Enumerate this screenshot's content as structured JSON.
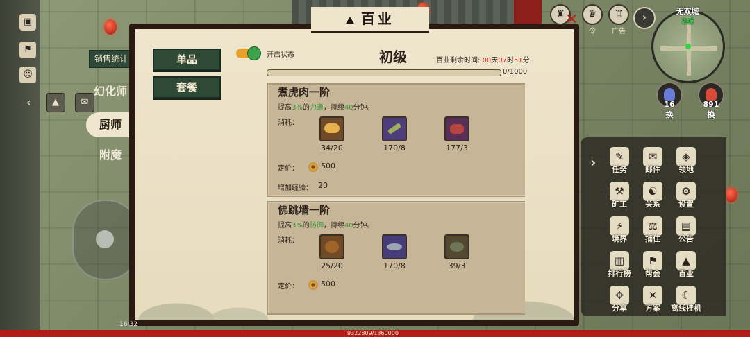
{
  "panel": {
    "title": "百业",
    "sidebar_sales": "销售统计",
    "categories": [
      {
        "label": "幻化师",
        "active": false
      },
      {
        "label": "厨师",
        "active": true
      },
      {
        "label": "附魔",
        "active": false
      }
    ],
    "sub_tabs": [
      "单品",
      "套餐"
    ],
    "toggle_label": "开启状态",
    "toggle_on": true,
    "level": "初级",
    "timer": {
      "prefix": "百业剩余时间:",
      "days": "00",
      "day_unit": "天",
      "hours": "07",
      "hour_unit": "时",
      "minutes": "51",
      "minute_unit": "分"
    },
    "progress": {
      "text": "0/1000",
      "fraction": 0.0
    },
    "consume_label": "消耗：",
    "price_label": "定价：",
    "exp_label": "增加经验：",
    "recipes": [
      {
        "name": "煮虎肉一阶",
        "desc_prefix": "提高",
        "desc_pct": "3%",
        "desc_mid": "的",
        "desc_stat": "力道",
        "desc_sep": "，持续",
        "desc_dur": "40",
        "desc_suffix": "分钟。",
        "materials": [
          {
            "icon": "bread-icon",
            "qty": "34/20"
          },
          {
            "icon": "herb-icon",
            "qty": "170/8"
          },
          {
            "icon": "meat-icon",
            "qty": "177/3"
          }
        ],
        "price": "500",
        "exp": "20"
      },
      {
        "name": "佛跳墙一阶",
        "desc_prefix": "提高",
        "desc_pct": "3%",
        "desc_mid": "的",
        "desc_stat": "防御",
        "desc_sep": "，持续",
        "desc_dur": "40",
        "desc_suffix": "分钟。",
        "materials": [
          {
            "icon": "nuts-icon",
            "qty": "25/20"
          },
          {
            "icon": "fish-icon",
            "qty": "170/8"
          },
          {
            "icon": "turtle-icon",
            "qty": "39/3"
          }
        ],
        "price": "500"
      }
    ]
  },
  "hud": {
    "top_icons": [
      {
        "icon": "gift-icon",
        "label": ""
      },
      {
        "icon": "order-icon",
        "label": "令"
      },
      {
        "icon": "ad-icon",
        "label": "广告"
      }
    ],
    "map_name": "无双城",
    "map_line": "2线",
    "potions": [
      {
        "icon": "blue-potion-icon",
        "count": "16",
        "label": "换"
      },
      {
        "icon": "red-potion-icon",
        "count": "891",
        "label": "换"
      }
    ],
    "menu": [
      {
        "icon": "task-icon",
        "glyph": "✎",
        "label": "任务"
      },
      {
        "icon": "mail-icon",
        "glyph": "✉",
        "label": "邮件"
      },
      {
        "icon": "claim-icon",
        "glyph": "◈",
        "label": "领地"
      },
      {
        "icon": "mining-icon",
        "glyph": "⚒",
        "label": "矿工"
      },
      {
        "icon": "relation-icon",
        "glyph": "☯",
        "label": "关系"
      },
      {
        "icon": "settings-icon",
        "glyph": "⚙",
        "label": "设置"
      },
      {
        "icon": "realm-icon",
        "glyph": "⚡",
        "label": "境界"
      },
      {
        "icon": "balance-icon",
        "glyph": "⚖",
        "label": "捕住"
      },
      {
        "icon": "notice-icon",
        "glyph": "▤",
        "label": "公告"
      },
      {
        "icon": "ranking-icon",
        "glyph": "▥",
        "label": "排行榜"
      },
      {
        "icon": "guild-icon",
        "glyph": "⚑",
        "label": "帮会"
      },
      {
        "icon": "profession-icon",
        "glyph": "▲",
        "label": "百业"
      },
      {
        "icon": "share-icon",
        "glyph": "✥",
        "label": "分享"
      },
      {
        "icon": "faction-icon",
        "glyph": "✕",
        "label": "方案"
      },
      {
        "icon": "afk-icon",
        "glyph": "☾",
        "label": "离线挂机"
      }
    ],
    "exp_bar_text": "9322809/1360000",
    "status_time": "16:32"
  },
  "colors": {
    "accent_green": "#2e4a37",
    "highlight_red": "#d0261f",
    "stat_green": "#2f9a37",
    "parchment": "#efe5cd"
  }
}
